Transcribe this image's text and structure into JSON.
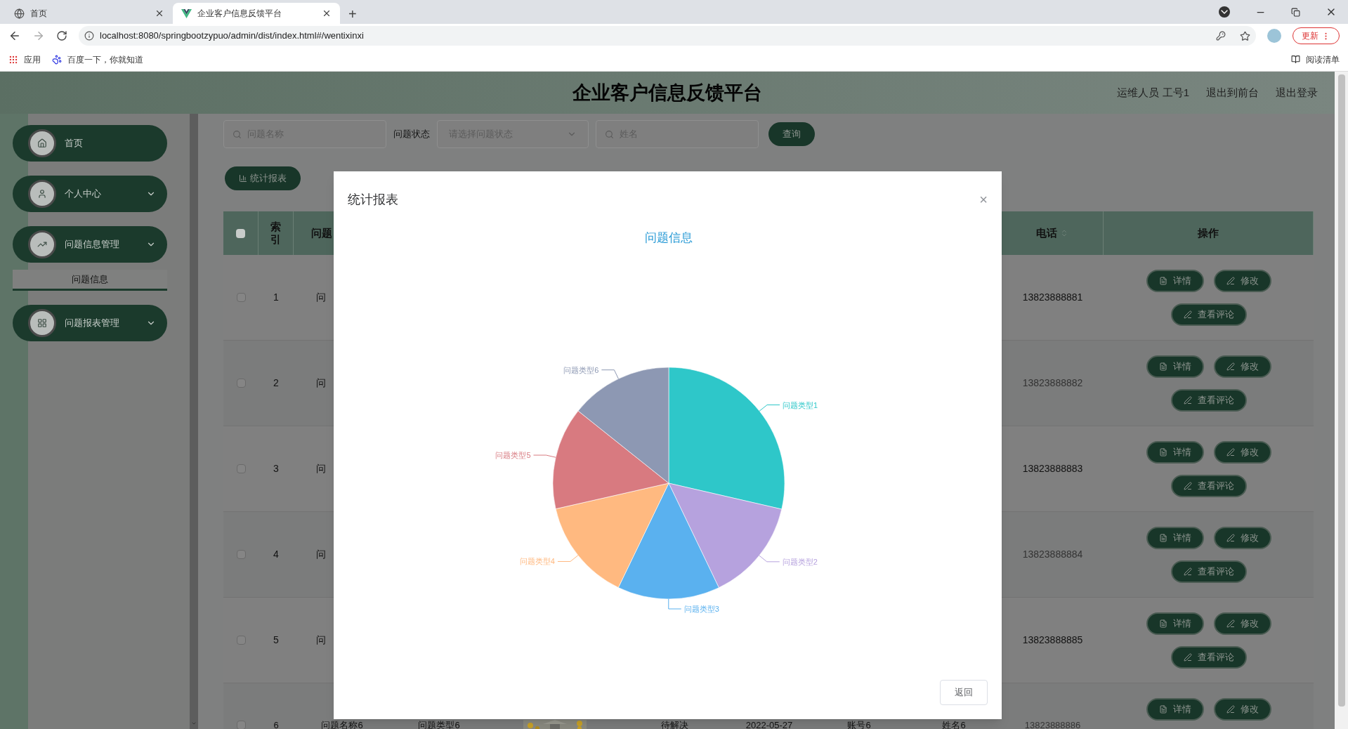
{
  "browser": {
    "tabs": [
      {
        "title": "首页",
        "selected": false
      },
      {
        "title": "企业客户信息反馈平台",
        "selected": true
      }
    ],
    "new_tab": "+",
    "url": "localhost:8080/springbootzypuo/admin/dist/index.html#/wentixinxi",
    "update_button": "更新",
    "bookmarks": [
      "应用",
      "百度一下，你就知道"
    ],
    "reading_list": "阅读清单"
  },
  "header": {
    "title": "企业客户信息反馈平台",
    "links": [
      "运维人员 工号1",
      "退出到前台",
      "退出登录"
    ]
  },
  "sidebar": {
    "items": [
      {
        "label": "首页",
        "kind": "link"
      },
      {
        "label": "个人中心",
        "kind": "menu"
      },
      {
        "label": "问题信息管理",
        "kind": "menu",
        "children": [
          {
            "label": "问题信息",
            "selected": true
          }
        ]
      },
      {
        "label": "问题报表管理",
        "kind": "menu"
      }
    ]
  },
  "search": {
    "fields": [
      {
        "kind": "text",
        "placeholder": "问题名称"
      },
      {
        "kind": "select",
        "label": "问题状态",
        "placeholder": "请选择问题状态"
      },
      {
        "kind": "text",
        "placeholder": "姓名"
      }
    ],
    "button": "查询"
  },
  "report_button": "统计报表",
  "table": {
    "all_checked": false,
    "columns": [
      {
        "kind": "checkbox"
      },
      {
        "kind": "text",
        "label": "索引"
      },
      {
        "kind": "text",
        "label": "问题"
      },
      {
        "kind": "sortable",
        "label": "电话"
      },
      {
        "kind": "text",
        "label": "操作"
      }
    ],
    "rows": [
      {
        "checked": false,
        "index": "1",
        "name": "问",
        "phone": "13823888881",
        "actions": [
          "详情",
          "修改",
          "查看评论"
        ]
      },
      {
        "checked": false,
        "index": "2",
        "name": "问",
        "phone": "13823888882",
        "actions": [
          "详情",
          "修改",
          "查看评论"
        ]
      },
      {
        "checked": false,
        "index": "3",
        "name": "问",
        "phone": "13823888883",
        "actions": [
          "详情",
          "修改",
          "查看评论"
        ]
      },
      {
        "checked": false,
        "index": "4",
        "name": "问",
        "phone": "13823888884",
        "actions": [
          "详情",
          "修改",
          "查看评论"
        ]
      },
      {
        "checked": false,
        "index": "5",
        "name": "问",
        "phone": "13823888885",
        "actions": [
          "详情",
          "修改",
          "查看评论"
        ]
      },
      {
        "checked": false,
        "index": "6",
        "name": "问题名称6",
        "type": "问题类型6",
        "image": {
          "kind": "picture"
        },
        "status": "待解决",
        "date": "2022-05-27",
        "account": "账号6",
        "person": "姓名6",
        "phone": "13823888886",
        "actions": [
          "详情",
          "修改"
        ]
      }
    ]
  },
  "dialog": {
    "title": "统计报表",
    "close": "×",
    "button": "返回",
    "chart_data": {
      "type": "pie",
      "title": "问题信息",
      "categories": [
        "问题类型1",
        "问题类型2",
        "问题类型3",
        "问题类型4",
        "问题类型5",
        "问题类型6"
      ],
      "values": [
        28.6,
        14.28,
        14.28,
        14.28,
        14.28,
        14.28
      ],
      "colors": [
        "#2ec7c9",
        "#b6a2de",
        "#5ab1ef",
        "#ffb980",
        "#d87a80",
        "#8d98b3"
      ]
    }
  }
}
